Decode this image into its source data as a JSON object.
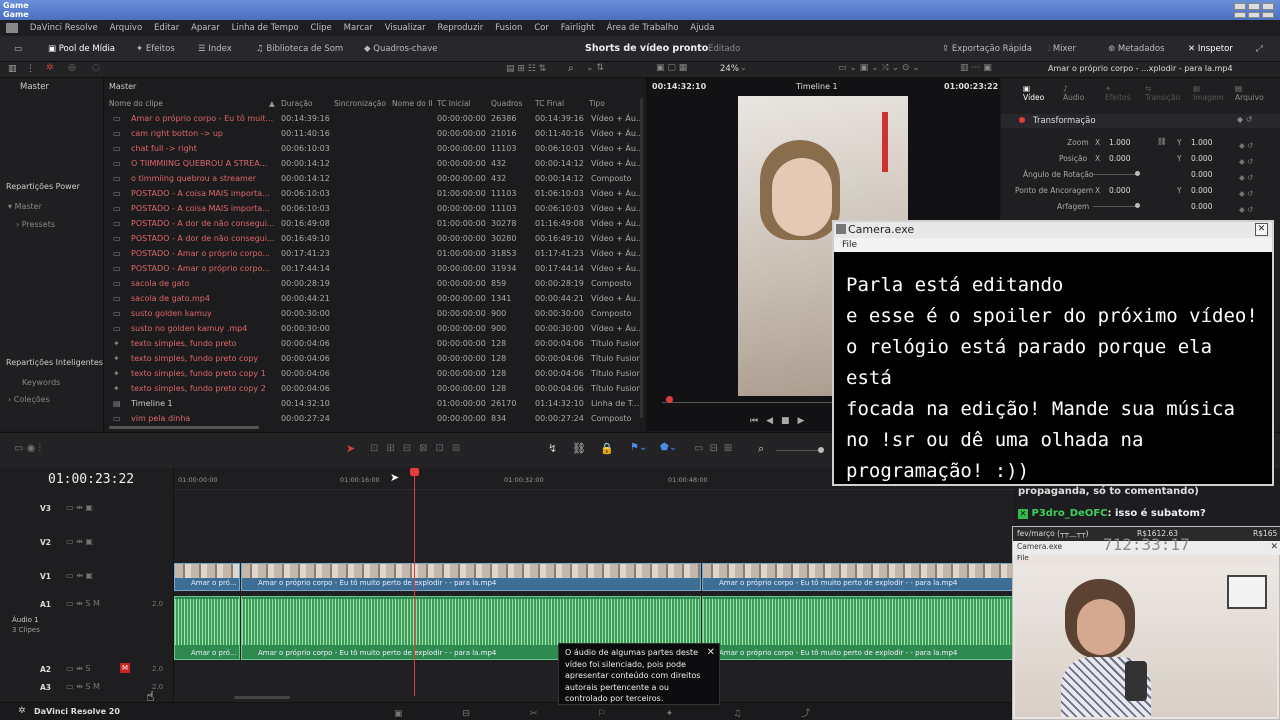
{
  "titlebar": {
    "line1": "Game",
    "line2": "Game"
  },
  "menubar": {
    "items": [
      "DaVinci Resolve",
      "Arquivo",
      "Editar",
      "Aparar",
      "Linha de Tempo",
      "Clipe",
      "Marcar",
      "Visualizar",
      "Reproduzir",
      "Fusion",
      "Cor",
      "Fairlight",
      "Área de Trabalho",
      "Ajuda"
    ]
  },
  "toolbar": {
    "media_pool": "Pool de Mídia",
    "effects": "Efeitos",
    "index": "Index",
    "sound_library": "Biblioteca de Som",
    "keyframes": "Quadros-chave",
    "project_title": "Shorts de vídeo pronto",
    "edited": "Editado",
    "quick_export": "Exportação Rápida",
    "mixer": "Mixer",
    "metadata": "Metadados",
    "inspector": "Inspetor"
  },
  "subbar": {
    "zoom": "24%",
    "timeline_name": "Timeline 1",
    "clip_title": "Amar o próprio corpo - ...xplodir - para la.mp4"
  },
  "leftpanel": {
    "master": "Master",
    "power_bins": "Repartições Power",
    "master_item": "Master",
    "presets": "Pressets",
    "smart_bins": "Repartições Inteligentes",
    "keywords": "Keywords",
    "collections": "Coleções"
  },
  "medialist": {
    "bin": "Master",
    "headers": {
      "name": "Nome do clipe",
      "duration": "Duração",
      "sync": "Sincronização",
      "name_ii": "Nome do II",
      "tc_in": "TC Inicial",
      "frames": "Quadros",
      "tc_out": "TC Final",
      "type": "Tipo"
    },
    "rows": [
      {
        "name": "Amar o próprio corpo - Eu tô muit...",
        "dur": "00:14:39:16",
        "tci": "00:00:00:00",
        "fr": "26386",
        "tcf": "00:14:39:16",
        "type": "Vídeo + Áu..."
      },
      {
        "name": "cam right botton -> up",
        "dur": "00:11:40:16",
        "tci": "00:00:00:00",
        "fr": "21016",
        "tcf": "00:11:40:16",
        "type": "Vídeo + Áu..."
      },
      {
        "name": "chat full -> right",
        "dur": "00:06:10:03",
        "tci": "00:00:00:00",
        "fr": "11103",
        "tcf": "00:06:10:03",
        "type": "Vídeo + Áu..."
      },
      {
        "name": "O TIIMMIING QUEBROU A STREA...",
        "dur": "00:00:14:12",
        "tci": "00:00:00:00",
        "fr": "432",
        "tcf": "00:00:14:12",
        "type": "Vídeo + Áu..."
      },
      {
        "name": "o timmiing quebrou a streamer",
        "dur": "00:00:14:12",
        "tci": "00:00:00:00",
        "fr": "432",
        "tcf": "00:00:14:12",
        "type": "Composto"
      },
      {
        "name": "POSTADO - A coisa MAIS importa...",
        "dur": "00:06:10:03",
        "tci": "01:00:00:00",
        "fr": "11103",
        "tcf": "01:06:10:03",
        "type": "Vídeo + Áu..."
      },
      {
        "name": "POSTADO - A coisa MAIS importa...",
        "dur": "00:06:10:03",
        "tci": "00:00:00:00",
        "fr": "11103",
        "tcf": "00:06:10:03",
        "type": "Vídeo + Áu..."
      },
      {
        "name": "POSTADO - A dor de não consegui...",
        "dur": "00:16:49:08",
        "tci": "01:00:00:00",
        "fr": "30278",
        "tcf": "01:16:49:08",
        "type": "Vídeo + Áu..."
      },
      {
        "name": "POSTADO - A dor de não consegui...",
        "dur": "00:16:49:10",
        "tci": "00:00:00:00",
        "fr": "30280",
        "tcf": "00:16:49:10",
        "type": "Vídeo + Áu..."
      },
      {
        "name": "POSTADO - Amar o próprio corpo...",
        "dur": "00:17:41:23",
        "tci": "01:00:00:00",
        "fr": "31853",
        "tcf": "01:17:41:23",
        "type": "Vídeo + Áu..."
      },
      {
        "name": "POSTADO - Amar o próprio corpo...",
        "dur": "00:17:44:14",
        "tci": "00:00:00:00",
        "fr": "31934",
        "tcf": "00:17:44:14",
        "type": "Vídeo + Áu..."
      },
      {
        "name": "sacola de gato",
        "dur": "00:00:28:19",
        "tci": "00:00:00:00",
        "fr": "859",
        "tcf": "00:00:28:19",
        "type": "Composto"
      },
      {
        "name": "sacola de gato.mp4",
        "dur": "00:00:44:21",
        "tci": "00:00:00:00",
        "fr": "1341",
        "tcf": "00:00:44:21",
        "type": "Vídeo + Áu..."
      },
      {
        "name": "susto golden kamuy",
        "dur": "00:00:30:00",
        "tci": "00:00:00:00",
        "fr": "900",
        "tcf": "00:00:30:00",
        "type": "Composto"
      },
      {
        "name": "susto no golden kamuy .mp4",
        "dur": "00:00:30:00",
        "tci": "00:00:00:00",
        "fr": "900",
        "tcf": "00:00:30:00",
        "type": "Vídeo + Áu..."
      },
      {
        "name": "texto simples, fundo preto",
        "dur": "00:00:04:06",
        "tci": "00:00:00:00",
        "fr": "128",
        "tcf": "00:00:04:06",
        "type": "Título Fusion"
      },
      {
        "name": "texto simples, fundo preto copy",
        "dur": "00:00:04:06",
        "tci": "00:00:00:00",
        "fr": "128",
        "tcf": "00:00:04:06",
        "type": "Título Fusion"
      },
      {
        "name": "texto simples, fundo preto copy 1",
        "dur": "00:00:04:06",
        "tci": "00:00:00:00",
        "fr": "128",
        "tcf": "00:00:04:06",
        "type": "Título Fusion"
      },
      {
        "name": "texto simples, fundo preto copy 2",
        "dur": "00:00:04:06",
        "tci": "00:00:00:00",
        "fr": "128",
        "tcf": "00:00:04:06",
        "type": "Título Fusion"
      },
      {
        "name": "Timeline 1",
        "dur": "00:14:32:10",
        "tci": "01:00:00:00",
        "fr": "26170",
        "tcf": "01:14:32:10",
        "type": "Linha de T..."
      },
      {
        "name": "vim pela dinha",
        "dur": "00:00:27:24",
        "tci": "00:00:00:00",
        "fr": "834",
        "tcf": "00:00:27:24",
        "type": "Composto"
      }
    ]
  },
  "viewer": {
    "tc_left": "00:14:32:10",
    "timeline": "Timeline 1",
    "tc_right": "01:00:23:22"
  },
  "inspector": {
    "tabs": [
      "Vídeo",
      "Áudio",
      "Efeitos",
      "Transição",
      "Imagem",
      "Arquivo"
    ],
    "section": "Transformação",
    "zoom_label": "Zoom",
    "zoom_x": "1.000",
    "zoom_y": "1.000",
    "position_label": "Posição",
    "pos_x": "0.000",
    "pos_y": "0.000",
    "rotation_label": "Ângulo de Rotação",
    "rotation": "0.000",
    "anchor_label": "Ponto de Ancoragem",
    "anchor_x": "0.000",
    "anchor_y": "0.000",
    "pitch_label": "Arfagem",
    "pitch": "0.000"
  },
  "camera_overlay": {
    "title": "Camera.exe",
    "menu": "File",
    "message": "Parla está editando\ne esse é o spoiler do próximo vídeo!\no relógio está parado porque ela está\nfocada na edição! Mande sua música\nno !sr ou dê uma olhada na\nprogramação!  :))"
  },
  "chat": {
    "line1": "propaganda, só to comentando)",
    "user": "P3dro_DeOFC",
    "message": ": isso é subatom?"
  },
  "cam2": {
    "header_left": "fev/março (┬┬﹏┬┬)",
    "header_right": "R$1612.63",
    "header_far": "R$165",
    "title": "Camera.exe",
    "menu": "File",
    "clock": "712:33:17"
  },
  "timeline": {
    "timecode": "01:00:23:22",
    "ruler": [
      "01:00:00:00",
      "01:00:16:00",
      "01:00:32:00",
      "01:00:48:00"
    ],
    "tracks": [
      {
        "id": "V3"
      },
      {
        "id": "V2"
      },
      {
        "id": "V1"
      },
      {
        "id": "A1",
        "vol": "2.0"
      },
      {
        "id": "A2",
        "vol": "2.0"
      },
      {
        "id": "A3",
        "vol": "2.0"
      }
    ],
    "audio_track_name": "Áudio 1",
    "audio_track_clips": "3 Clipes",
    "clip_short": "Amar o pró...",
    "clip_full": "Amar o próprio corpo - Eu tô muito perto de explodir - - para la.mp4",
    "clip_right": "Amar o próprio corpo - Eu tô muito perto de explodir - - para la.mp4"
  },
  "toast": {
    "text": "O áudio de algumas partes deste vídeo foi silenciado, pois pode apresentar conteúdo com direitos autorais pertencente a ou controlado por terceiros."
  },
  "bottombar": {
    "app": "DaVinci Resolve 20"
  },
  "colors": {
    "accent": "#d63b3b",
    "clip_video": "#3d6e95",
    "clip_audio": "#2f8a4f",
    "playhead": "#e23c3c"
  }
}
